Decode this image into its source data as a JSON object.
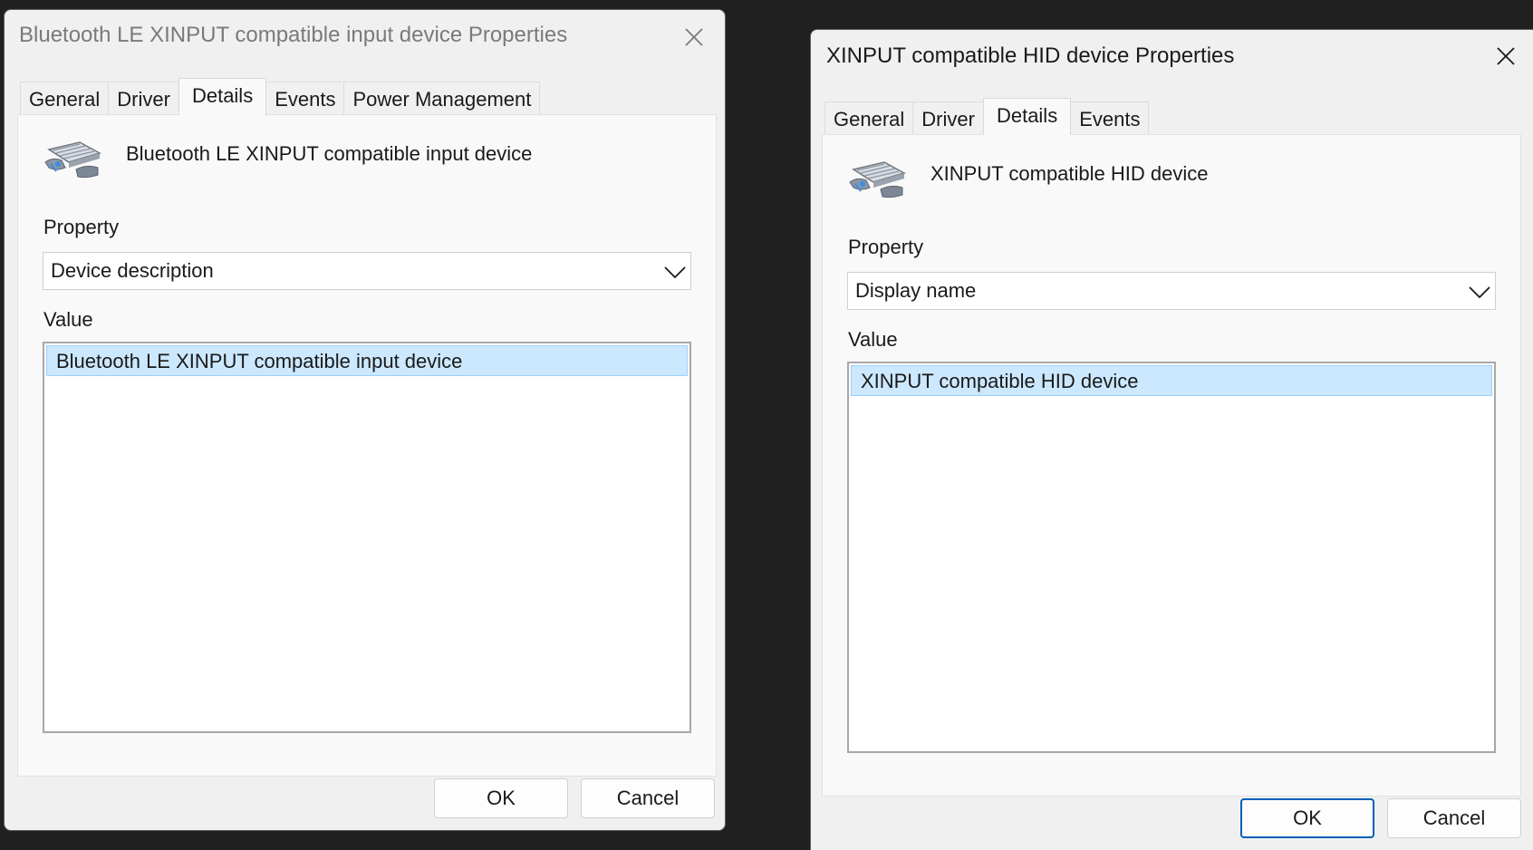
{
  "left_dialog": {
    "title": "Bluetooth LE XINPUT compatible input device Properties",
    "tabs": [
      {
        "label": "General"
      },
      {
        "label": "Driver"
      },
      {
        "label": "Details"
      },
      {
        "label": "Events"
      },
      {
        "label": "Power Management"
      }
    ],
    "active_tab": "Details",
    "device_icon": "gamepad-device-icon",
    "device_name": "Bluetooth LE XINPUT compatible input device",
    "property_label": "Property",
    "property_selected": "Device description",
    "value_label": "Value",
    "values": [
      "Bluetooth LE XINPUT compatible input device"
    ],
    "ok_label": "OK",
    "cancel_label": "Cancel",
    "active": false
  },
  "right_dialog": {
    "title": "XINPUT compatible HID device Properties",
    "tabs": [
      {
        "label": "General"
      },
      {
        "label": "Driver"
      },
      {
        "label": "Details"
      },
      {
        "label": "Events"
      }
    ],
    "active_tab": "Details",
    "device_icon": "gamepad-device-icon",
    "device_name": "XINPUT compatible HID device",
    "property_label": "Property",
    "property_selected": "Display name",
    "value_label": "Value",
    "values": [
      "XINPUT compatible HID device"
    ],
    "ok_label": "OK",
    "cancel_label": "Cancel",
    "active": true
  },
  "colors": {
    "desktop": "#202020",
    "dialog_bg": "#f0f0f0",
    "panel_bg": "#f9f9f9",
    "selection": "#cce8ff",
    "accent": "#005fb8"
  }
}
